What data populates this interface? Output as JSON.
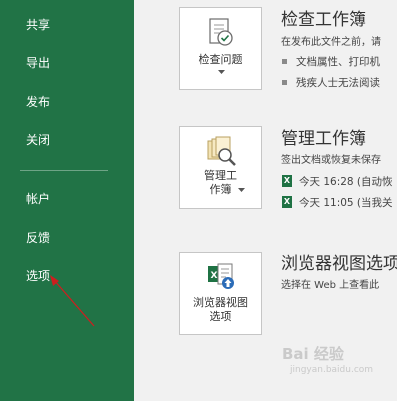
{
  "sidebar": {
    "items": [
      {
        "label": "共享"
      },
      {
        "label": "导出"
      },
      {
        "label": "发布"
      },
      {
        "label": "关闭"
      },
      {
        "label": "帐户"
      },
      {
        "label": "反馈"
      },
      {
        "label": "选项"
      }
    ]
  },
  "sections": {
    "inspect": {
      "button_label": "检查问题",
      "title": "检查工作簿",
      "description": "在发布此文件之前，请",
      "bullets": [
        "文档属性、打印机",
        "残疾人士无法阅读"
      ]
    },
    "manage": {
      "button_label": "管理工\n作簿",
      "title": "管理工作簿",
      "description": "签出文档或恢复未保存",
      "versions": [
        "今天 16:28 (自动恢",
        "今天 11:05 (当我关"
      ]
    },
    "browser": {
      "button_label": "浏览器视图\n选项",
      "title": "浏览器视图选项",
      "description": "选择在 Web 上查看此"
    }
  },
  "watermark": {
    "text": "Bai 经验",
    "sub": "jingyan.baidu.com"
  },
  "colors": {
    "sidebar": "#217346",
    "content_bg": "#f1f1f1",
    "annotation_arrow": "#cc1f1f"
  }
}
